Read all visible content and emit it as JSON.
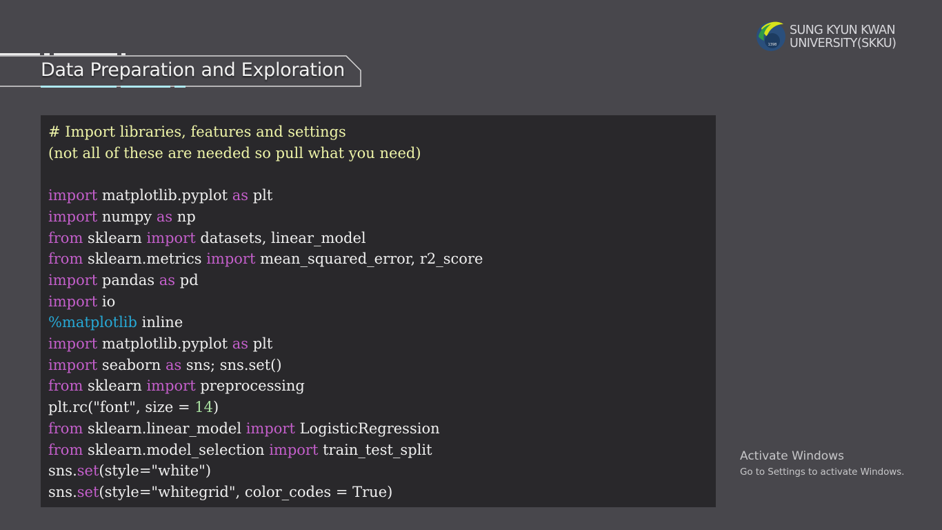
{
  "slide": {
    "title": "Data Preparation and Exploration",
    "logo": {
      "badge_year": "1398",
      "line1": "SUNG KYUN KWAN",
      "line2": "UNIVERSITY(SKKU)"
    }
  },
  "code": {
    "lines": [
      [
        {
          "t": "# Import libraries, features and settings",
          "c": "comment"
        }
      ],
      [
        {
          "t": "(not all of these are needed so pull what you need)",
          "c": "comment"
        }
      ],
      [],
      [
        {
          "t": "import",
          "c": "kw"
        },
        {
          "t": " matplotlib.pyplot ",
          "c": "plain"
        },
        {
          "t": "as",
          "c": "kw"
        },
        {
          "t": " plt",
          "c": "plain"
        }
      ],
      [
        {
          "t": "import",
          "c": "kw"
        },
        {
          "t": " numpy ",
          "c": "plain"
        },
        {
          "t": "as",
          "c": "kw"
        },
        {
          "t": " np",
          "c": "plain"
        }
      ],
      [
        {
          "t": "from",
          "c": "kw"
        },
        {
          "t": " sklearn ",
          "c": "plain"
        },
        {
          "t": "import",
          "c": "kw"
        },
        {
          "t": " datasets, linear_model",
          "c": "plain"
        }
      ],
      [
        {
          "t": "from",
          "c": "kw"
        },
        {
          "t": " sklearn.metrics ",
          "c": "plain"
        },
        {
          "t": "import",
          "c": "kw"
        },
        {
          "t": " mean_squared_error, r2_score",
          "c": "plain"
        }
      ],
      [
        {
          "t": "import",
          "c": "kw"
        },
        {
          "t": " pandas ",
          "c": "plain"
        },
        {
          "t": "as",
          "c": "kw"
        },
        {
          "t": " pd",
          "c": "plain"
        }
      ],
      [
        {
          "t": "import",
          "c": "kw"
        },
        {
          "t": " io",
          "c": "plain"
        }
      ],
      [
        {
          "t": "%matplotlib",
          "c": "magic"
        },
        {
          "t": " inline",
          "c": "plain"
        }
      ],
      [
        {
          "t": "import",
          "c": "kw"
        },
        {
          "t": " matplotlib.pyplot ",
          "c": "plain"
        },
        {
          "t": "as",
          "c": "kw"
        },
        {
          "t": " plt",
          "c": "plain"
        }
      ],
      [
        {
          "t": "import",
          "c": "kw"
        },
        {
          "t": " seaborn ",
          "c": "plain"
        },
        {
          "t": "as",
          "c": "kw"
        },
        {
          "t": " sns; sns.set()",
          "c": "plain"
        }
      ],
      [
        {
          "t": "from",
          "c": "kw"
        },
        {
          "t": " sklearn ",
          "c": "plain"
        },
        {
          "t": "import",
          "c": "kw"
        },
        {
          "t": " preprocessing",
          "c": "plain"
        }
      ],
      [
        {
          "t": "plt.rc(\"font\", size = ",
          "c": "plain"
        },
        {
          "t": "14",
          "c": "num"
        },
        {
          "t": ")",
          "c": "plain"
        }
      ],
      [
        {
          "t": "from",
          "c": "kw"
        },
        {
          "t": " sklearn.linear_model ",
          "c": "plain"
        },
        {
          "t": "import",
          "c": "kw"
        },
        {
          "t": " LogisticRegression",
          "c": "plain"
        }
      ],
      [
        {
          "t": "from",
          "c": "kw"
        },
        {
          "t": " sklearn.model_selection ",
          "c": "plain"
        },
        {
          "t": "import",
          "c": "kw"
        },
        {
          "t": " train_test_split",
          "c": "plain"
        }
      ],
      [
        {
          "t": "sns.",
          "c": "plain"
        },
        {
          "t": "set",
          "c": "kw"
        },
        {
          "t": "(style=\"white\")",
          "c": "plain"
        }
      ],
      [
        {
          "t": "sns.",
          "c": "plain"
        },
        {
          "t": "set",
          "c": "kw"
        },
        {
          "t": "(style=\"whitegrid\", color_codes = True)",
          "c": "plain"
        }
      ]
    ]
  },
  "watermark": {
    "title": "Activate Windows",
    "subtitle": "Go to Settings to activate Windows."
  },
  "colors": {
    "background": "#48474c",
    "code_bg": "#29282b",
    "comment": "#eef4a8",
    "keyword": "#c45fcb",
    "magic": "#27a9d6",
    "number": "#a9e0a1",
    "accent": "#aeeaf2"
  }
}
